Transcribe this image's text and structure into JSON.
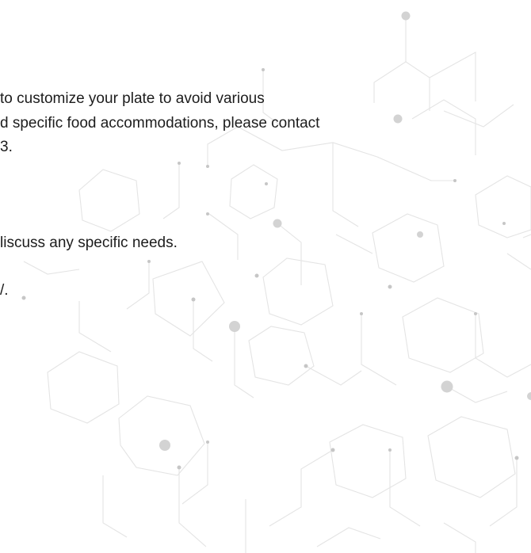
{
  "document": {
    "paragraph_one": {
      "line_1": "to customize your plate to avoid various",
      "line_2": "d specific food accommodations, please contact",
      "line_3": "3."
    },
    "paragraph_two": {
      "line_1": "liscuss any specific needs.",
      "line_2": "/."
    }
  },
  "background": {
    "pattern_icon": "hexagon-network-pattern",
    "line_color": "#e4e4e4",
    "dot_color": "#d3d3d3"
  }
}
